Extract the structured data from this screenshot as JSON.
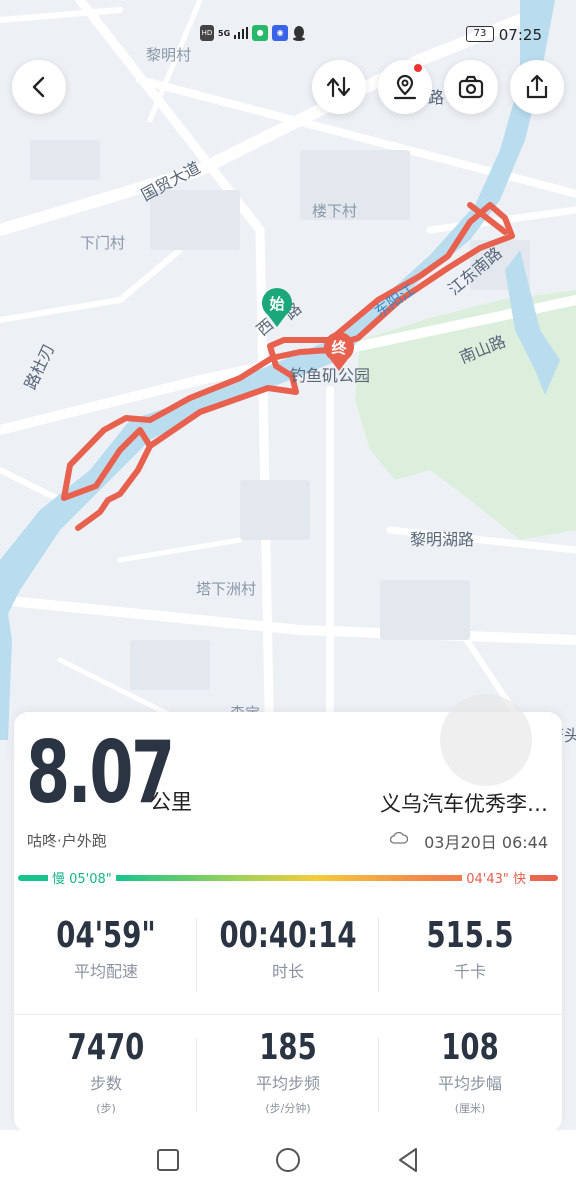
{
  "status_bar": {
    "time": "07:25",
    "battery": "73",
    "signal_label": "HD",
    "network": "5G"
  },
  "map": {
    "labels": {
      "liming_village": "黎明村",
      "guomao_avenue": "国贸大道",
      "xiamen_village": "下门村",
      "louxia_village": "楼下村",
      "dongyang_river": "东阳江",
      "jiangdong_south_road": "江东南路",
      "nanshan_road": "南山路",
      "diaoyuji_park": "钓鱼矶公园",
      "limingh_lake_road": "黎明湖路",
      "taxiazhou_village": "塔下洲村",
      "west_road": "西",
      "west_road_2": "路",
      "left_road": "路杜刃",
      "top_road": "路",
      "bottom_partial": "森宝",
      "bottom_right_partial": "唐头"
    },
    "start_marker": "始",
    "end_marker": "终",
    "track_color": "#e8604e",
    "start_color": "#1aa77a"
  },
  "top_buttons": {
    "back_icon": "chevron-left-icon",
    "route_icon": "route-swap-icon",
    "location_icon": "location-pin-icon",
    "camera_icon": "camera-icon",
    "share_icon": "share-icon"
  },
  "summary": {
    "distance": "8.07",
    "distance_unit": "公里",
    "route_name": "义乌汽车优秀李…",
    "sport_type": "咕咚·户外跑",
    "datetime": "03月20日 06:44",
    "pace_slow_label": "慢 05'08\"",
    "pace_fast_label": "04'43\" 快"
  },
  "stats_row1": [
    {
      "value": "04'59\"",
      "label": "平均配速"
    },
    {
      "value": "00:40:14",
      "label": "时长"
    },
    {
      "value": "515.5",
      "label": "千卡"
    }
  ],
  "stats_row2": [
    {
      "value": "7470",
      "label": "步数",
      "unit": "(步)"
    },
    {
      "value": "185",
      "label": "平均步频",
      "unit": "(步/分钟)"
    },
    {
      "value": "108",
      "label": "平均步幅",
      "unit": "(厘米)"
    }
  ],
  "nav_bar": {
    "recent_icon": "square-icon",
    "home_icon": "circle-icon",
    "back_icon": "triangle-back-icon"
  }
}
